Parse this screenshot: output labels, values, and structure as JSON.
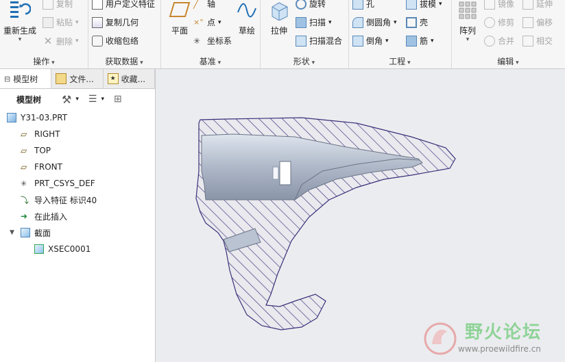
{
  "ribbon": {
    "operations": {
      "label": "操作",
      "regenerate": "重新生成",
      "copy": "复制",
      "paste": "粘贴",
      "delete": "删除"
    },
    "get_data": {
      "label": "获取数据",
      "udf": "用户定义特征",
      "copy_geometry": "复制几何",
      "shrinkwrap": "收缩包络"
    },
    "datum": {
      "label": "基准",
      "plane": "平面",
      "axis": "轴",
      "point": "点",
      "csys": "坐标系",
      "sketch": "草绘"
    },
    "shapes": {
      "label": "形状",
      "extrude": "拉伸",
      "revolve": "旋转",
      "sweep": "扫描",
      "swept_blend": "扫描混合"
    },
    "engineering": {
      "label": "工程",
      "hole": "孔",
      "round": "倒圆角",
      "chamfer": "倒角",
      "draft": "拔模",
      "shell": "壳",
      "rib": "筋"
    },
    "editing": {
      "label": "编辑",
      "pattern": "阵列",
      "mirror": "镜像",
      "trim": "修剪",
      "merge": "合并",
      "extend": "延伸",
      "offset": "偏移",
      "intersect": "相交"
    }
  },
  "panel": {
    "tabs": [
      "模型树",
      "文件...",
      "收藏..."
    ],
    "tree_header": "模型树",
    "nodes": [
      {
        "label": "Y31-03.PRT",
        "icon": "part-icon"
      },
      {
        "label": "RIGHT",
        "icon": "datum-plane-icon"
      },
      {
        "label": "TOP",
        "icon": "datum-plane-icon"
      },
      {
        "label": "FRONT",
        "icon": "datum-plane-icon"
      },
      {
        "label": "PRT_CSYS_DEF",
        "icon": "csys-icon"
      },
      {
        "label": "导入特征 标识40",
        "icon": "import-feature-icon"
      },
      {
        "label": "在此插入",
        "icon": "insert-arrow-icon"
      },
      {
        "label": "截面",
        "icon": "section-folder-icon"
      },
      {
        "label": "XSEC0001",
        "icon": "xsection-icon"
      }
    ]
  },
  "watermark": {
    "title": "野火论坛",
    "url": "www.proewildfire.cn"
  },
  "colors": {
    "hatch": "#3b2f7a",
    "surface": "#b9c3d2",
    "accent_green": "#2fa84f",
    "watermark_red": "#e57373"
  }
}
